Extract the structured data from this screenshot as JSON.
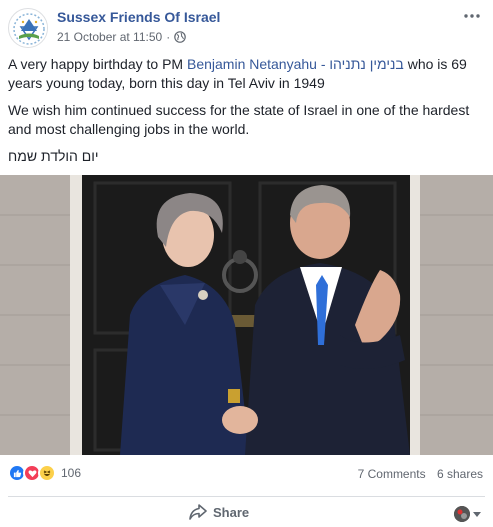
{
  "post": {
    "page_name": "Sussex Friends Of Israel",
    "timestamp": "21 October at 11:50",
    "dot": "·",
    "privacy_icon": "globe-icon",
    "more_icon": "more-dots-icon",
    "avatar_icon": "page-logo",
    "text": {
      "p1_before": "A very happy birthday to PM ",
      "p1_mention": "Benjamin Netanyahu - בנימין נתניהו",
      "p1_after": " who is 69 years young today, born this day in Tel Aviv in 1949",
      "p2": "We wish him continued success for the state of Israel in one of the hardest and most challenging jobs in the world.",
      "p3": "יום הולדת שמח"
    },
    "photo_icon": "photo-two-leaders-handshake"
  },
  "stats": {
    "reaction_icons": [
      "like-icon",
      "love-icon",
      "haha-icon"
    ],
    "reaction_count": "106",
    "comments": "7 Comments",
    "shares": "6 shares"
  },
  "actions": {
    "share_label": "Share",
    "share_icon": "share-arrow-icon",
    "profile_switch_icon": "chevron-down-icon"
  },
  "colors": {
    "link_blue": "#365899",
    "like_blue": "#2078f4",
    "love_red": "#f33e58",
    "haha_yellow": "#fcd04a"
  }
}
